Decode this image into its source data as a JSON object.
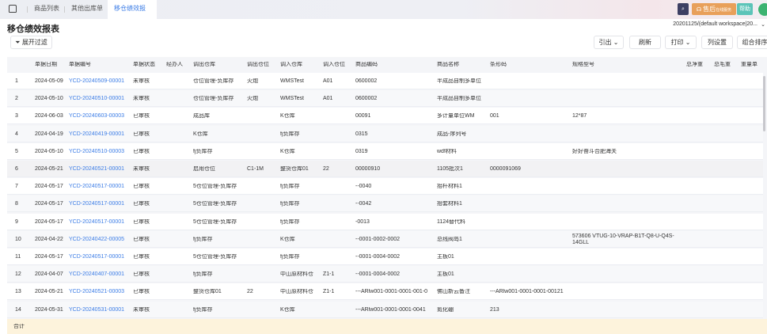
{
  "tabs": [
    {
      "label": "商品列表"
    },
    {
      "label": "其他出库单"
    },
    {
      "label": "移仓绩效报表",
      "active": true
    }
  ],
  "header_right": {
    "service_label": "售后",
    "service_sub": "在线服务",
    "help_label": "帮助"
  },
  "page": {
    "title": "移仓绩效报表",
    "workspace": "20201125/(default workspace|20...",
    "filter_label": "展开过滤"
  },
  "toolbar": {
    "export": "引出",
    "refresh": "刷新",
    "print": "打印",
    "columns": "列设置",
    "sort": "组合排序"
  },
  "columns": [
    "",
    "单据日期",
    "单据编号",
    "单据状态",
    "经办人",
    "调出仓库",
    "调出仓位",
    "调入仓库",
    "调入仓位",
    "商品编码",
    "商品名称",
    "条形码",
    "规格型号",
    "总净重",
    "总毛重",
    "重量单"
  ],
  "rows": [
    [
      "1",
      "2024-05-09",
      "YCD-20240509-00001",
      "未审核",
      "",
      "仓位管理-负库存",
      "火炮",
      "WMSTest",
      "A01",
      "0600002",
      "半成品自制多单位",
      "",
      "",
      "",
      "",
      ""
    ],
    [
      "2",
      "2024-05-10",
      "YCD-20240510-00001",
      "未审核",
      "",
      "仓位管理-负库存",
      "火炮",
      "WMSTest",
      "A01",
      "0600002",
      "半成品自制多单位",
      "",
      "",
      "",
      "",
      ""
    ],
    [
      "3",
      "2024-06-03",
      "YCD-20240603-00003",
      "已审核",
      "",
      "成品库",
      "",
      "K仓库",
      "",
      "00091",
      "多计量单位WM",
      "001",
      "12*87",
      "",
      "",
      ""
    ],
    [
      "4",
      "2024-04-19",
      "YCD-20240419-00001",
      "已审核",
      "",
      "K仓库",
      "",
      "fj负库存",
      "",
      "0315",
      "成品-序列号",
      "",
      "",
      "",
      "",
      ""
    ],
    [
      "5",
      "2024-05-10",
      "YCD-20240510-00003",
      "已审核",
      "",
      "fj负库存",
      "",
      "K仓库",
      "",
      "0319",
      "wdf材料",
      "",
      "好好奋斗合肥海关",
      "",
      "",
      ""
    ],
    [
      "6",
      "2024-05-21",
      "YCD-20240521-00001",
      "未审核",
      "",
      "启用仓位",
      "C1-1M",
      "整货仓库01",
      "22",
      "00000910",
      "1105批次1",
      "0000091069",
      "",
      "",
      "",
      ""
    ],
    [
      "7",
      "2024-05-17",
      "YCD-20240517-00001",
      "已审核",
      "",
      "5仓位管理-负库存",
      "",
      "fj负库存",
      "",
      "--0040",
      "抬杆材料1",
      "",
      "",
      "",
      "",
      ""
    ],
    [
      "8",
      "2024-05-17",
      "YCD-20240517-00001",
      "已审核",
      "",
      "5仓位管理-负库存",
      "",
      "fj负库存",
      "",
      "--0042",
      "抬套材料1",
      "",
      "",
      "",
      "",
      ""
    ],
    [
      "9",
      "2024-05-17",
      "YCD-20240517-00001",
      "已审核",
      "",
      "5仓位管理-负库存",
      "",
      "fj负库存",
      "",
      "-0013",
      "1124替代料",
      "",
      "",
      "",
      "",
      ""
    ],
    [
      "10",
      "2024-04-22",
      "YCD-20240422-00005",
      "已审核",
      "",
      "fj负库存",
      "",
      "K仓库",
      "",
      "--0001-0002-0002",
      "总线阀岛1",
      "",
      "573606  VTUG-10-VRAP-B1T-Q8-U-Q4S-14GLL",
      "",
      "",
      ""
    ],
    [
      "11",
      "2024-05-17",
      "YCD-20240517-00001",
      "已审核",
      "",
      "5仓位管理-负库存",
      "",
      "fj负库存",
      "",
      "--0001-0004-0002",
      "主板01",
      "",
      "",
      "",
      "",
      ""
    ],
    [
      "12",
      "2024-04-07",
      "YCD-20240407-00001",
      "已审核",
      "",
      "fj负库存",
      "",
      "中山原材料仓",
      "Z1-1",
      "--0001-0004-0002",
      "主板01",
      "",
      "",
      "",
      "",
      ""
    ],
    [
      "13",
      "2024-05-21",
      "YCD-20240521-00003",
      "已审核",
      "",
      "整货仓库01",
      "22",
      "中山原材料仓",
      "Z1-1",
      "---ARlw001-0001-0001-001-0",
      "佛山新云备注",
      "---ARlw001-0001-0001-00121",
      "",
      "",
      "",
      ""
    ],
    [
      "14",
      "2024-05-31",
      "YCD-20240531-00001",
      "未审核",
      "",
      "fj负库存",
      "",
      "K仓库",
      "",
      "---ARlw001-0001-0001-0041",
      "氮化硼",
      "213",
      "",
      "",
      "",
      ""
    ]
  ],
  "footer": {
    "total_label": "合计"
  },
  "colors": {
    "accent": "#3b7ce6",
    "total_bg": "#fdf3dc",
    "service": "#e8a05a",
    "help": "#5cc4b8",
    "search": "#3d3f63"
  }
}
